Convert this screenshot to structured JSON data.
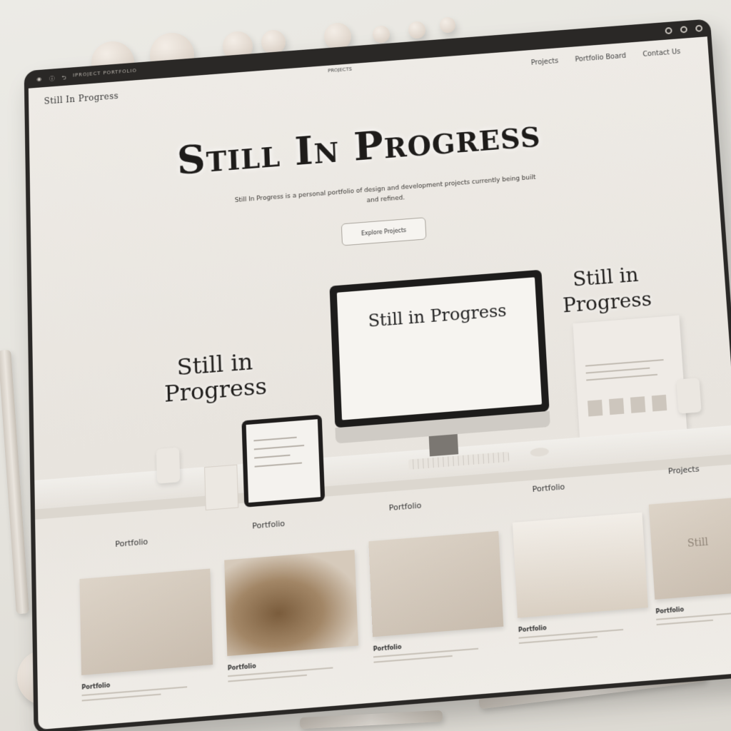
{
  "browser": {
    "tab_title": "IPROJECT PORTFOLIO"
  },
  "header": {
    "brand": "Still In Progress",
    "nav_center": "PROJECTS",
    "nav": [
      "Projects",
      "Portfolio Board",
      "Contact Us"
    ]
  },
  "hero": {
    "title": "Still In Progress",
    "subtitle": "Still In Progress is a personal portfolio of design and development projects currently being built and refined.",
    "cta_label": "Explore Projects"
  },
  "showcase": {
    "left_text": "Still in Progress",
    "monitor_text": "Still in Progress",
    "right_text": "Still in Progress"
  },
  "sections": {
    "portfolio_label": "Portfolio",
    "labels": [
      "Portfolio",
      "Portfolio",
      "Portfolio",
      "Portfolio",
      "Projects"
    ]
  },
  "cards": [
    {
      "title": "Portfolio"
    },
    {
      "title": "Portfolio"
    },
    {
      "title": "Portfolio"
    },
    {
      "title": "Portfolio"
    },
    {
      "title": "Portfolio",
      "overlay": "Still"
    }
  ],
  "colors": {
    "accent": "#1e1c1a",
    "background": "#e8e4de",
    "bezel": "#2a2826"
  }
}
